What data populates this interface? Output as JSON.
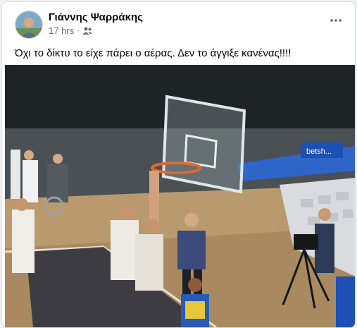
{
  "post": {
    "author": "Γιάννης Ψαρράκης",
    "time": "17 hrs",
    "separator": "·",
    "audience_icon": "friends-icon",
    "more_icon": "more-options-icon",
    "text": "Όχι το δίκτυ το είχε πάρει ο αέρας. Δεν το άγγιξε κανένας!!!!"
  },
  "media": {
    "sponsor_text": "betsh..."
  }
}
